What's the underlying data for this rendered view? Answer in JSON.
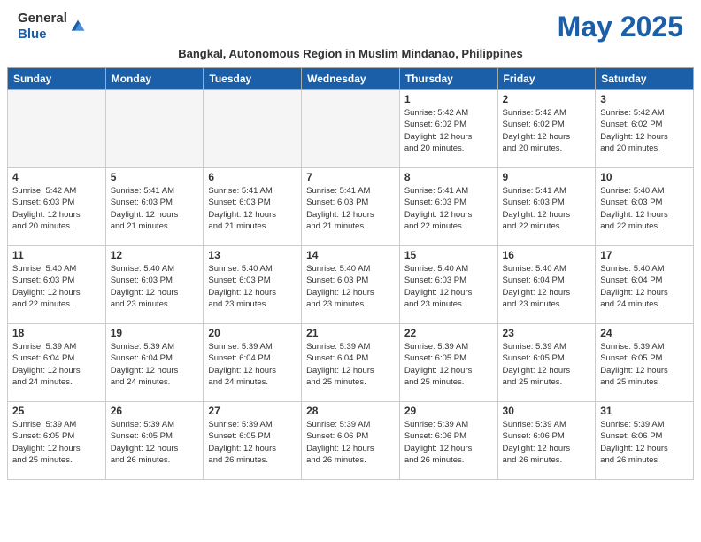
{
  "header": {
    "logo_general": "General",
    "logo_blue": "Blue",
    "month_title": "May 2025",
    "subtitle": "Bangkal, Autonomous Region in Muslim Mindanao, Philippines"
  },
  "weekdays": [
    "Sunday",
    "Monday",
    "Tuesday",
    "Wednesday",
    "Thursday",
    "Friday",
    "Saturday"
  ],
  "weeks": [
    [
      {
        "day": "",
        "info": ""
      },
      {
        "day": "",
        "info": ""
      },
      {
        "day": "",
        "info": ""
      },
      {
        "day": "",
        "info": ""
      },
      {
        "day": "1",
        "info": "Sunrise: 5:42 AM\nSunset: 6:02 PM\nDaylight: 12 hours\nand 20 minutes."
      },
      {
        "day": "2",
        "info": "Sunrise: 5:42 AM\nSunset: 6:02 PM\nDaylight: 12 hours\nand 20 minutes."
      },
      {
        "day": "3",
        "info": "Sunrise: 5:42 AM\nSunset: 6:02 PM\nDaylight: 12 hours\nand 20 minutes."
      }
    ],
    [
      {
        "day": "4",
        "info": "Sunrise: 5:42 AM\nSunset: 6:03 PM\nDaylight: 12 hours\nand 20 minutes."
      },
      {
        "day": "5",
        "info": "Sunrise: 5:41 AM\nSunset: 6:03 PM\nDaylight: 12 hours\nand 21 minutes."
      },
      {
        "day": "6",
        "info": "Sunrise: 5:41 AM\nSunset: 6:03 PM\nDaylight: 12 hours\nand 21 minutes."
      },
      {
        "day": "7",
        "info": "Sunrise: 5:41 AM\nSunset: 6:03 PM\nDaylight: 12 hours\nand 21 minutes."
      },
      {
        "day": "8",
        "info": "Sunrise: 5:41 AM\nSunset: 6:03 PM\nDaylight: 12 hours\nand 22 minutes."
      },
      {
        "day": "9",
        "info": "Sunrise: 5:41 AM\nSunset: 6:03 PM\nDaylight: 12 hours\nand 22 minutes."
      },
      {
        "day": "10",
        "info": "Sunrise: 5:40 AM\nSunset: 6:03 PM\nDaylight: 12 hours\nand 22 minutes."
      }
    ],
    [
      {
        "day": "11",
        "info": "Sunrise: 5:40 AM\nSunset: 6:03 PM\nDaylight: 12 hours\nand 22 minutes."
      },
      {
        "day": "12",
        "info": "Sunrise: 5:40 AM\nSunset: 6:03 PM\nDaylight: 12 hours\nand 23 minutes."
      },
      {
        "day": "13",
        "info": "Sunrise: 5:40 AM\nSunset: 6:03 PM\nDaylight: 12 hours\nand 23 minutes."
      },
      {
        "day": "14",
        "info": "Sunrise: 5:40 AM\nSunset: 6:03 PM\nDaylight: 12 hours\nand 23 minutes."
      },
      {
        "day": "15",
        "info": "Sunrise: 5:40 AM\nSunset: 6:03 PM\nDaylight: 12 hours\nand 23 minutes."
      },
      {
        "day": "16",
        "info": "Sunrise: 5:40 AM\nSunset: 6:04 PM\nDaylight: 12 hours\nand 23 minutes."
      },
      {
        "day": "17",
        "info": "Sunrise: 5:40 AM\nSunset: 6:04 PM\nDaylight: 12 hours\nand 24 minutes."
      }
    ],
    [
      {
        "day": "18",
        "info": "Sunrise: 5:39 AM\nSunset: 6:04 PM\nDaylight: 12 hours\nand 24 minutes."
      },
      {
        "day": "19",
        "info": "Sunrise: 5:39 AM\nSunset: 6:04 PM\nDaylight: 12 hours\nand 24 minutes."
      },
      {
        "day": "20",
        "info": "Sunrise: 5:39 AM\nSunset: 6:04 PM\nDaylight: 12 hours\nand 24 minutes."
      },
      {
        "day": "21",
        "info": "Sunrise: 5:39 AM\nSunset: 6:04 PM\nDaylight: 12 hours\nand 25 minutes."
      },
      {
        "day": "22",
        "info": "Sunrise: 5:39 AM\nSunset: 6:05 PM\nDaylight: 12 hours\nand 25 minutes."
      },
      {
        "day": "23",
        "info": "Sunrise: 5:39 AM\nSunset: 6:05 PM\nDaylight: 12 hours\nand 25 minutes."
      },
      {
        "day": "24",
        "info": "Sunrise: 5:39 AM\nSunset: 6:05 PM\nDaylight: 12 hours\nand 25 minutes."
      }
    ],
    [
      {
        "day": "25",
        "info": "Sunrise: 5:39 AM\nSunset: 6:05 PM\nDaylight: 12 hours\nand 25 minutes."
      },
      {
        "day": "26",
        "info": "Sunrise: 5:39 AM\nSunset: 6:05 PM\nDaylight: 12 hours\nand 26 minutes."
      },
      {
        "day": "27",
        "info": "Sunrise: 5:39 AM\nSunset: 6:05 PM\nDaylight: 12 hours\nand 26 minutes."
      },
      {
        "day": "28",
        "info": "Sunrise: 5:39 AM\nSunset: 6:06 PM\nDaylight: 12 hours\nand 26 minutes."
      },
      {
        "day": "29",
        "info": "Sunrise: 5:39 AM\nSunset: 6:06 PM\nDaylight: 12 hours\nand 26 minutes."
      },
      {
        "day": "30",
        "info": "Sunrise: 5:39 AM\nSunset: 6:06 PM\nDaylight: 12 hours\nand 26 minutes."
      },
      {
        "day": "31",
        "info": "Sunrise: 5:39 AM\nSunset: 6:06 PM\nDaylight: 12 hours\nand 26 minutes."
      }
    ]
  ]
}
